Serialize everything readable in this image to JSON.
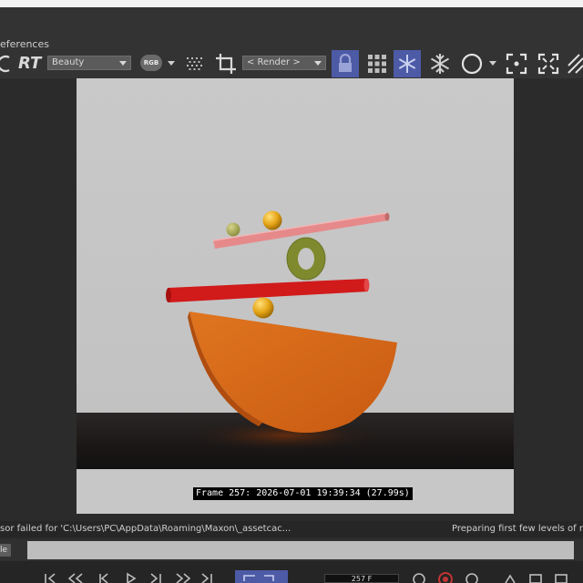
{
  "window": {
    "title_fragment": "eferences"
  },
  "toolbar": {
    "rt_label": "RT",
    "pass_select": {
      "value": "Beauty"
    },
    "rgb_label": "RGB",
    "render_select": {
      "value": "< Render >"
    },
    "icons": [
      "refresh-icon",
      "rgb-channel-icon",
      "dither-grid-icon",
      "crop-icon",
      "lock-icon",
      "grid-icon",
      "snowflake-icon",
      "snowflake-alt-icon",
      "circle-icon",
      "focus-icon",
      "expand-icon",
      "pattern-icon"
    ],
    "highlight_color": "#4d5aa6"
  },
  "viewport": {
    "frame_stamp": "Frame 257: 2026-07-01 19:39:34 (27.99s)",
    "background_color": "#c6c6c6",
    "objects": [
      {
        "name": "orange-half-disc",
        "color": "#d9671a"
      },
      {
        "name": "red-bar",
        "color": "#d21a1a"
      },
      {
        "name": "pink-bar",
        "color": "#e58a8a"
      },
      {
        "name": "olive-torus",
        "color": "#7f8a2e"
      },
      {
        "name": "yellow-sphere-bottom",
        "color": "#e8a817"
      },
      {
        "name": "yellow-sphere-top",
        "color": "#e8a817"
      },
      {
        "name": "olive-sphere-small",
        "color": "#a7a85a"
      }
    ]
  },
  "status": {
    "left_text": "sor failed for 'C:\\Users\\PC\\AppData\\Roaming\\Maxon\\_assetcac...",
    "right_text": "Preparing first few levels of r"
  },
  "progress": {
    "label": "le",
    "fraction": 0.0
  },
  "bottom": {
    "frame_field": "257 F",
    "icons": [
      "first-frame-icon",
      "prev-key-icon",
      "prev-frame-icon",
      "play-icon",
      "next-frame-icon",
      "next-key-icon",
      "last-frame-icon",
      "loop-icon",
      "record-icon"
    ]
  }
}
